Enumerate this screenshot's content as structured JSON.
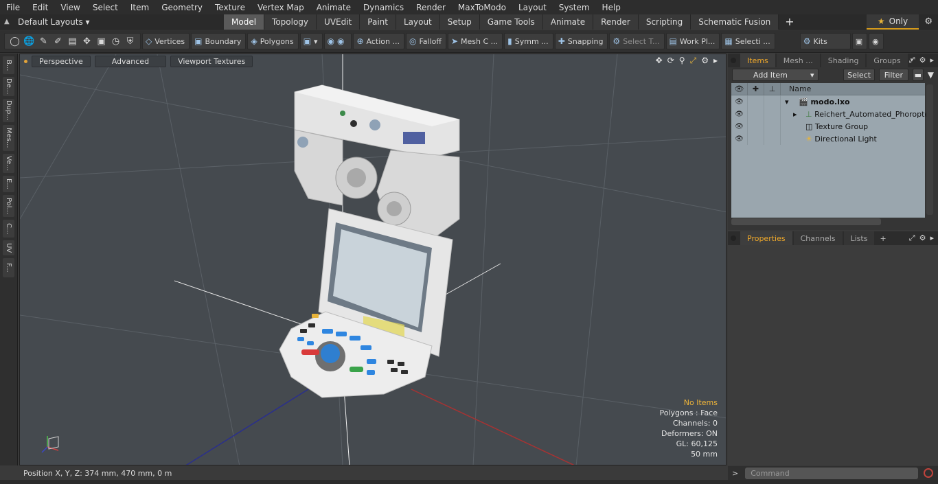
{
  "menu": [
    "File",
    "Edit",
    "View",
    "Select",
    "Item",
    "Geometry",
    "Texture",
    "Vertex Map",
    "Animate",
    "Dynamics",
    "Render",
    "MaxToModo",
    "Layout",
    "System",
    "Help"
  ],
  "layouts": {
    "label": "Default Layouts ▾"
  },
  "tabs": [
    "Model",
    "Topology",
    "UVEdit",
    "Paint",
    "Layout",
    "Setup",
    "Game Tools",
    "Animate",
    "Render",
    "Scripting",
    "Schematic Fusion"
  ],
  "active_tab": "Model",
  "only_label": "Only",
  "toolbar": {
    "vertices": "Vertices",
    "boundary": "Boundary",
    "polygons": "Polygons",
    "action": "Action",
    "falloff": "Falloff",
    "meshc": "Mesh C ...",
    "symm": "Symm ...",
    "snapping": "Snapping",
    "select_t": "Select T...",
    "workpl": "Work Pl...",
    "selecti": "Selecti ...",
    "kits": "Kits"
  },
  "left_tabs": [
    "B...",
    "De...",
    "Dup...",
    "Mes...",
    "Ve...",
    "E...",
    "Pol...",
    "C...",
    "UV",
    "F..."
  ],
  "viewport": {
    "view": "Perspective",
    "shading": "Advanced",
    "textures": "Viewport Textures",
    "stats": {
      "items": "No Items",
      "polygons": "Polygons : Face",
      "channels": "Channels: 0",
      "deformers": "Deformers: ON",
      "gl": "GL: 60,125",
      "unit": "50 mm"
    }
  },
  "status": "Position X, Y, Z:  374 mm, 470 mm, 0 m",
  "items_panel": {
    "tabs": [
      "Items",
      "Mesh ...",
      "Shading",
      "Groups"
    ],
    "add_item": "Add Item",
    "select": "Select",
    "filter": "Filter",
    "name_col": "Name",
    "rows": [
      {
        "name": "modo.lxo"
      },
      {
        "name": "Reichert_Automated_Phoropter"
      },
      {
        "name": "Texture Group"
      },
      {
        "name": "Directional Light"
      }
    ]
  },
  "props_panel": {
    "tabs": [
      "Properties",
      "Channels",
      "Lists"
    ]
  },
  "command": {
    "placeholder": "Command"
  },
  "colors": {
    "accent": "#f0a92a",
    "viewport_bg": "#454a4f",
    "item_bg": "#9aa6ae"
  }
}
